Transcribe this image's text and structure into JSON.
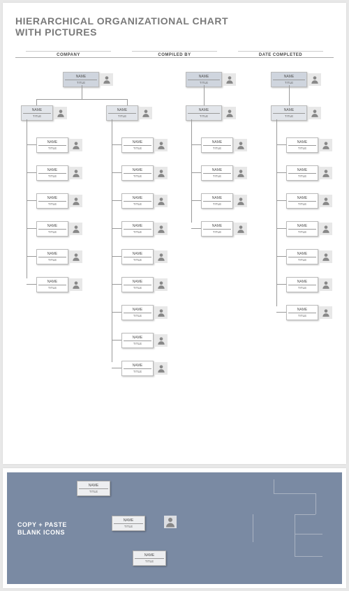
{
  "doc": {
    "title_line1": "HIERARCHICAL ORGANIZATIONAL CHART",
    "title_line2": "WITH PICTURES",
    "meta": {
      "company": "COMPANY",
      "compiled_by": "COMPILED BY",
      "date_completed": "DATE COMPLETED"
    }
  },
  "labels": {
    "name": "NAME",
    "title": "TITLE"
  },
  "copy_paste": {
    "line1": "COPY + PASTE",
    "line2": "BLANK ICONS"
  },
  "columns": {
    "left": {
      "top": {
        "name": "NAME",
        "title": "TITLE",
        "style": "head"
      },
      "sub1": {
        "name": "NAME",
        "title": "TITLE",
        "style": "mgr",
        "children": [
          {
            "name": "NAME",
            "title": "TITLE"
          },
          {
            "name": "NAME",
            "title": "TITLE"
          },
          {
            "name": "NAME",
            "title": "TITLE"
          },
          {
            "name": "NAME",
            "title": "TITLE"
          },
          {
            "name": "NAME",
            "title": "TITLE"
          },
          {
            "name": "NAME",
            "title": "TITLE"
          }
        ]
      },
      "sub2": {
        "name": "NAME",
        "title": "TITLE",
        "style": "mgr",
        "children": [
          {
            "name": "NAME",
            "title": "TITLE"
          },
          {
            "name": "NAME",
            "title": "TITLE"
          },
          {
            "name": "NAME",
            "title": "TITLE"
          },
          {
            "name": "NAME",
            "title": "TITLE"
          },
          {
            "name": "NAME",
            "title": "TITLE"
          },
          {
            "name": "NAME",
            "title": "TITLE"
          },
          {
            "name": "NAME",
            "title": "TITLE"
          },
          {
            "name": "NAME",
            "title": "TITLE"
          },
          {
            "name": "NAME",
            "title": "TITLE"
          }
        ]
      }
    },
    "mid": {
      "top": {
        "name": "NAME",
        "title": "TITLE",
        "style": "head"
      },
      "sub1": {
        "name": "NAME",
        "title": "TITLE",
        "style": "mgr",
        "children": [
          {
            "name": "NAME",
            "title": "TITLE"
          },
          {
            "name": "NAME",
            "title": "TITLE"
          },
          {
            "name": "NAME",
            "title": "TITLE"
          },
          {
            "name": "NAME",
            "title": "TITLE"
          }
        ]
      }
    },
    "right": {
      "top": {
        "name": "NAME",
        "title": "TITLE",
        "style": "head"
      },
      "sub1": {
        "name": "NAME",
        "title": "TITLE",
        "style": "mgr",
        "children": [
          {
            "name": "NAME",
            "title": "TITLE"
          },
          {
            "name": "NAME",
            "title": "TITLE"
          },
          {
            "name": "NAME",
            "title": "TITLE"
          },
          {
            "name": "NAME",
            "title": "TITLE"
          },
          {
            "name": "NAME",
            "title": "TITLE"
          },
          {
            "name": "NAME",
            "title": "TITLE"
          },
          {
            "name": "NAME",
            "title": "TITLE"
          }
        ]
      }
    }
  },
  "blank_nodes": [
    {
      "name": "NAME",
      "title": "TITLE"
    },
    {
      "name": "NAME",
      "title": "TITLE"
    },
    {
      "name": "NAME",
      "title": "TITLE"
    }
  ]
}
